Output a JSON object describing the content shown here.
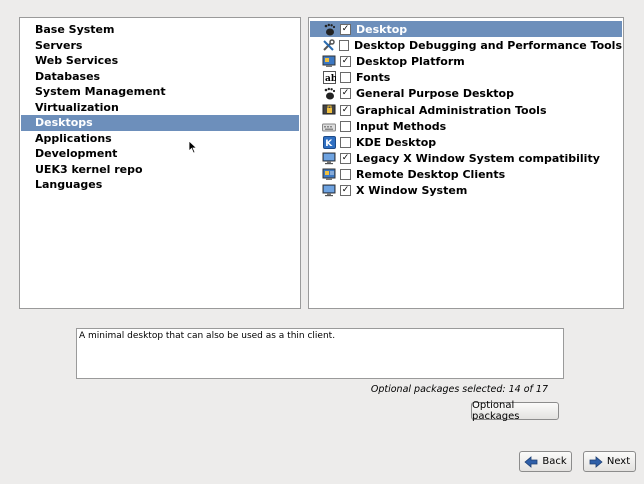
{
  "categories": [
    {
      "label": "Base System",
      "selected": false
    },
    {
      "label": "Servers",
      "selected": false
    },
    {
      "label": "Web Services",
      "selected": false
    },
    {
      "label": "Databases",
      "selected": false
    },
    {
      "label": "System Management",
      "selected": false
    },
    {
      "label": "Virtualization",
      "selected": false
    },
    {
      "label": "Desktops",
      "selected": true
    },
    {
      "label": "Applications",
      "selected": false
    },
    {
      "label": "Development",
      "selected": false
    },
    {
      "label": "UEK3 kernel repo",
      "selected": false
    },
    {
      "label": "Languages",
      "selected": false
    }
  ],
  "groups": [
    {
      "label": "Desktop",
      "checked": true,
      "icon": "gnome-foot-icon",
      "selected": true
    },
    {
      "label": "Desktop Debugging and Performance Tools",
      "checked": false,
      "icon": "tools-icon",
      "selected": false
    },
    {
      "label": "Desktop Platform",
      "checked": true,
      "icon": "desktop-platform-icon",
      "selected": false
    },
    {
      "label": "Fonts",
      "checked": false,
      "icon": "fonts-icon",
      "selected": false
    },
    {
      "label": "General Purpose Desktop",
      "checked": true,
      "icon": "gnome-foot-icon",
      "selected": false
    },
    {
      "label": "Graphical Administration Tools",
      "checked": true,
      "icon": "admin-tools-icon",
      "selected": false
    },
    {
      "label": "Input Methods",
      "checked": false,
      "icon": "keyboard-icon",
      "selected": false
    },
    {
      "label": "KDE Desktop",
      "checked": false,
      "icon": "kde-icon",
      "selected": false
    },
    {
      "label": "Legacy X Window System compatibility",
      "checked": true,
      "icon": "monitor-icon",
      "selected": false
    },
    {
      "label": "Remote Desktop Clients",
      "checked": false,
      "icon": "remote-desktop-icon",
      "selected": false
    },
    {
      "label": "X Window System",
      "checked": true,
      "icon": "monitor-icon",
      "selected": false
    }
  ],
  "description": "A minimal desktop that can also be used as a thin client.",
  "optional_status": "Optional packages selected: 14 of 17",
  "buttons": {
    "optional": "Optional packages",
    "back": "Back",
    "next": "Next"
  },
  "colors": {
    "selection": "#6d8fbb",
    "background": "#edeceb"
  }
}
